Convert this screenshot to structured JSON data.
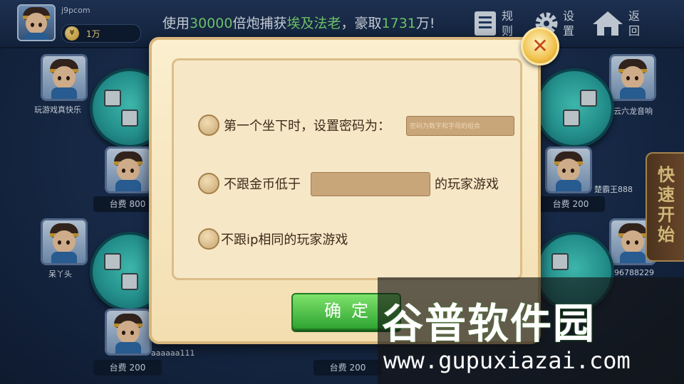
{
  "header": {
    "username": "j9pcom",
    "coins": "1万",
    "marquee": {
      "prefix": "使用",
      "highlight1": "30000",
      "mid1": "倍炮捕获",
      "highlight2": "埃及法老",
      "mid2": "，豪取",
      "highlight3": "1731",
      "suffix": "万!"
    },
    "rules_label": "规则",
    "settings_label": "设置",
    "back_label": "返回"
  },
  "players": {
    "p1": "玩游戏真快乐",
    "p2": "缙云六龙音响",
    "p3": "楚霸王888",
    "p4": "呆丫头",
    "p5": "96788229",
    "p6": "aaaaaa111"
  },
  "fees": {
    "f1": "台费 800",
    "f2": "台费 200",
    "f3": "台费 200",
    "f4": "台费 200"
  },
  "quick_start": "快速开始",
  "dialog": {
    "option1_label": "第一个坐下时，设置密码为：",
    "option1_placeholder": "密码为数字和字母的组合",
    "option2_prefix": "不跟金币低于",
    "option2_suffix": "的玩家游戏",
    "option3_label": "不跟ip相同的玩家游戏",
    "confirm_label": "确定"
  },
  "watermark": {
    "cn": "谷普软件园",
    "en": "www.gupuxiazai.com"
  },
  "colors": {
    "accent_green": "#7fe07a",
    "dialog_bg": "#f6e7c7",
    "confirm_button": "#2fa431",
    "close_button": "#f0c14a"
  },
  "icons": [
    "rules-icon",
    "settings-gear-icon",
    "home-icon",
    "coin-icon",
    "close-icon",
    "radio-icon",
    "mahjong-tile-icon"
  ]
}
